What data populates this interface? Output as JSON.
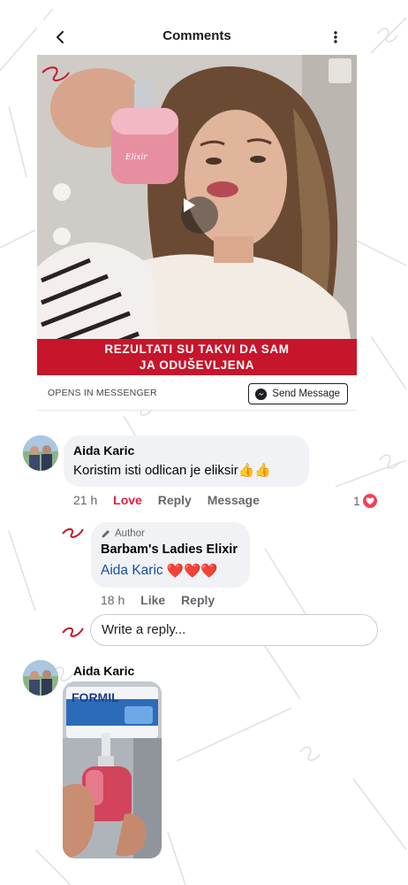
{
  "header": {
    "title": "Comments"
  },
  "ad": {
    "caption_line1": "REZULTATI SU TAKVI DA SAM",
    "caption_line2": "JA ODUŠEVLJENA",
    "cta_label": "OPENS IN MESSENGER",
    "send_button": "Send Message"
  },
  "comment1": {
    "author": "Aida Karic",
    "text": "Koristim isti odlican je eliksir👍👍",
    "time": "21 h",
    "reaction_action": "Love",
    "reply_action": "Reply",
    "message_action": "Message",
    "reaction_count": "1"
  },
  "reply1": {
    "badge": "Author",
    "author": "Barbam's Ladies Elixir",
    "mention": "Aida Karic",
    "hearts": "❤️❤️❤️",
    "time": "18 h",
    "like_action": "Like",
    "reply_action": "Reply"
  },
  "reply_box": {
    "placeholder": "Write a reply..."
  },
  "comment2": {
    "author": "Aida Karic",
    "photo_label": "FORMIL"
  },
  "colors": {
    "brand_red": "#c7152b",
    "love_red": "#e41e3f",
    "link_blue": "#1c4ba0",
    "bubble_bg": "#f0f2f5"
  }
}
